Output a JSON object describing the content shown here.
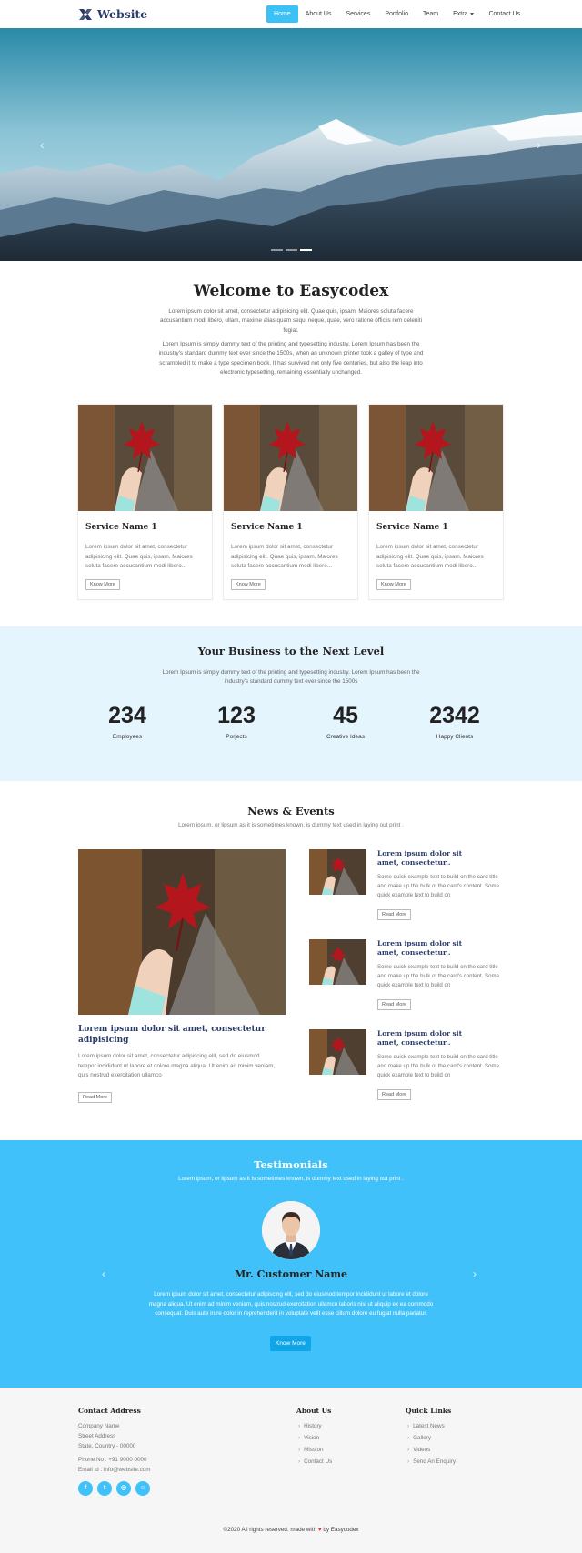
{
  "nav": {
    "brand": "Website",
    "logo_icon": "x-logo-icon",
    "items": [
      {
        "label": "Home",
        "active": true
      },
      {
        "label": "About Us"
      },
      {
        "label": "Services"
      },
      {
        "label": "Portfolio"
      },
      {
        "label": "Team"
      },
      {
        "label": "Extra",
        "dropdown": true
      },
      {
        "label": "Contact Us"
      }
    ]
  },
  "hero": {
    "prev_icon": "chevron-left-icon",
    "next_icon": "chevron-right-icon",
    "slides": 3,
    "active_slide": 3
  },
  "welcome": {
    "title": "Welcome to Easycodex",
    "p1": "Lorem ipsum dolor sit amet, consectetur adipisicing elit. Quae quis, ipsam. Maiores soluta facere accusantium modi libero, ullam, maxime alias quam sequi neque, quae, vero ratione officiis rem deleniti fugiat.",
    "p2": "Lorem Ipsum is simply dummy text of the printing and typesetting industry. Lorem Ipsum has been the industry's standard dummy text ever since the 1500s, when an unknown printer took a galley of type and scrambled it to make a type specimen book. It has survived not only five centuries, but also the leap into electronic typesetting, remaining essentially unchanged."
  },
  "services": [
    {
      "title": "Service Name 1",
      "text": "Lorem ipsum dolor sit amet, consectetur adipisicing elit. Quae quis, ipsam. Maiores soluta facere accusantium modi libero...",
      "button": "Know More"
    },
    {
      "title": "Service Name 1",
      "text": "Lorem ipsum dolor sit amet, consectetur adipisicing elit. Quae quis, ipsam. Maiores soluta facere accusantium modi libero...",
      "button": "Know More"
    },
    {
      "title": "Service Name 1",
      "text": "Lorem ipsum dolor sit amet, consectetur adipisicing elit. Quae quis, ipsam. Maiores soluta facere accusantium modi libero...",
      "button": "Know More"
    }
  ],
  "stats": {
    "title": "Your Business to the Next Level",
    "text": "Lorem Ipsum is simply dummy text of the printing and typesetting industry. Lorem Ipsum has been the industry's standard dummy text ever since the 1500s",
    "items": [
      {
        "number": "234",
        "label": "Employees"
      },
      {
        "number": "123",
        "label": "Porjects"
      },
      {
        "number": "45",
        "label": "Creative Ideas"
      },
      {
        "number": "2342",
        "label": "Happy Clients"
      }
    ]
  },
  "news": {
    "title": "News & Events",
    "subtitle": "Lorem ipsum, or lipsum as it is sometimes known, is dummy text used in laying out print .",
    "featured": {
      "title": "Lorem ipsum dolor sit amet, consectetur adipisicing",
      "text": "Lorem ipsum dolor sit amet, consectetur adipiscing elit, sed do eiusmod tempor incididunt ut labore et dolore magna aliqua. Ut enim ad minim veniam, quis nostrud exercitation ullamco",
      "button": "Read More"
    },
    "items": [
      {
        "title": "Lorem ipsum dolor sit amet, consectetur..",
        "text": "Some quick example text to build on the card title and make up the bulk of the card's content. Some quick example text to build on",
        "button": "Read More"
      },
      {
        "title": "Lorem ipsum dolor sit amet, consectetur..",
        "text": "Some quick example text to build on the card title and make up the bulk of the card's content. Some quick example text to build on",
        "button": "Read More"
      },
      {
        "title": "Lorem ipsum dolor sit amet, consectetur..",
        "text": "Some quick example text to build on the card title and make up the bulk of the card's content. Some quick example text to build on",
        "button": "Read More"
      }
    ]
  },
  "testimonials": {
    "title": "Testimonials",
    "subtitle": "Lorem ipsum, or lipsum as it is sometimes known, is dummy text used in laying out print .",
    "name": "Mr. Customer Name",
    "text": "Lorem ipsum dolor sit amet, consectetur adipiscing elit, sed do eiusmod tempor incididunt ut labore et dolore magna aliqua. Ut enim ad minim veniam, quis nostrud exercitation ullamco laboris nisi ut aliquip ex ea commodo consequat. Duis aute irure dolor in reprehenderit in voluptate velit esse cillum dolore eu fugiat nulla pariatur.",
    "button": "Know More"
  },
  "footer": {
    "contact": {
      "title": "Contact Address",
      "company": "Company Name",
      "street": "Street Address",
      "state": "State, Country - 00000",
      "phone": "Phone No : +91 9000 0000",
      "email": "Email Id : info@website.com"
    },
    "about": {
      "title": "About Us",
      "links": [
        "History",
        "Vision",
        "Mission",
        "Contact Us"
      ]
    },
    "quick": {
      "title": "Quick Links",
      "links": [
        "Latest News",
        "Gallery",
        "Videos",
        "Send An Enquiry"
      ]
    },
    "social": [
      "facebook-icon",
      "twitter-icon",
      "instagram-icon",
      "snapchat-icon"
    ],
    "copyright_pre": "©2020 All rights reserved. made with",
    "copyright_post": "by Easycodex"
  },
  "colors": {
    "accent": "#41c1f9",
    "brand": "#2a3b6b",
    "stats_bg": "#e5f5fd",
    "footer_bg": "#f6f6f6"
  }
}
